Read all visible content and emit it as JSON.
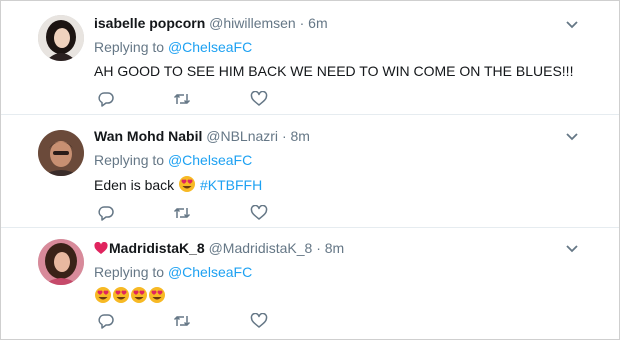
{
  "tweets": [
    {
      "name": "isabelle popcorn",
      "handle": "@hiwillemsen",
      "dot": "·",
      "time": "6m",
      "replying_prefix": "Replying to ",
      "replying_to": "@ChelseaFC",
      "text": "AH GOOD TO SEE HIM BACK WE NEED TO WIN COME ON THE BLUES!!!"
    },
    {
      "name": "Wan Mohd Nabil",
      "handle": "@NBLnazri",
      "dot": "·",
      "time": "8m",
      "replying_prefix": "Replying to ",
      "replying_to": "@ChelseaFC",
      "text": "Eden is back",
      "hashtag": "#KTBFFH"
    },
    {
      "name": "MadridistaK_8",
      "handle": "@MadridistaK_8",
      "dot": "·",
      "time": "8m",
      "replying_prefix": "Replying to ",
      "replying_to": "@ChelseaFC",
      "emoji_count": 4
    }
  ],
  "icons": {
    "reply": "reply-icon",
    "retweet": "retweet-icon",
    "like": "heart-icon",
    "more": "chevron-down-icon",
    "emoji": "heart-eyes-emoji",
    "name_badge": "red-heart-emoji"
  },
  "colors": {
    "link": "#1da1f2",
    "muted": "#657786",
    "text": "#14171a",
    "emoji_face": "#f7b924",
    "emoji_heart": "#e0245e"
  }
}
